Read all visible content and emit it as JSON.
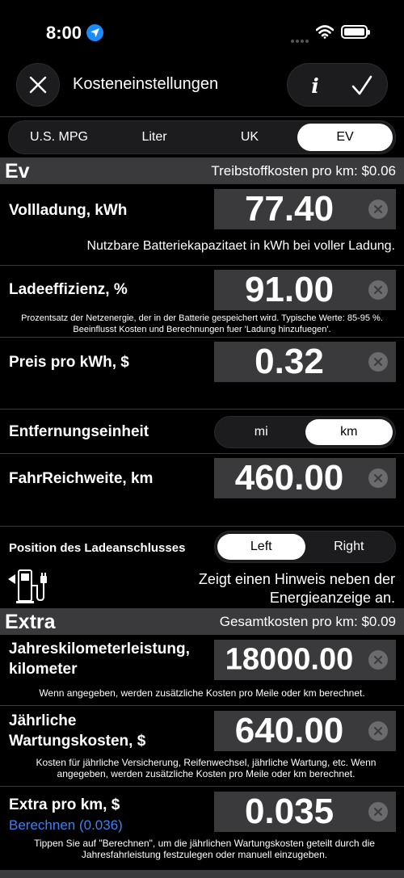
{
  "status": {
    "time": "8:00"
  },
  "nav": {
    "title": "Kosteneinstellungen",
    "info_label": "i"
  },
  "units": {
    "options": [
      "U.S. MPG",
      "Liter",
      "UK",
      "EV"
    ],
    "selected": "EV"
  },
  "ev_section": {
    "title": "Ev",
    "subtitle": "Treibstoffkosten pro km: $0.06"
  },
  "full_charge": {
    "label": "Vollladung, kWh",
    "value": "77.40",
    "hint": "Nutzbare Batteriekapazitaet in kWh bei voller Ladung."
  },
  "charge_efficiency": {
    "label": "Ladeeffizienz, %",
    "value": "91.00",
    "hint": "Prozentsatz der Netzenergie, der in der Batterie gespeichert wird. Typische Werte: 85-95 %. Beeinflusst Kosten und Berechnungen fuer 'Ladung hinzufuegen'."
  },
  "price_kwh": {
    "label": "Preis pro kWh, $",
    "value": "0.32"
  },
  "distance_unit": {
    "label": "Entfernungseinheit",
    "options": [
      "mi",
      "km"
    ],
    "selected": "km"
  },
  "range": {
    "label": "FahrReichweite, km",
    "value": "460.00"
  },
  "charge_port": {
    "label": "Position des Ladeanschlusses",
    "options": [
      "Left",
      "Right"
    ],
    "selected": "Left",
    "hint": "Zeigt einen Hinweis neben der Energieanzeige an."
  },
  "extra_section": {
    "title": "Extra",
    "subtitle": "Gesamtkosten pro km: $0.09"
  },
  "annual_km": {
    "label": "Jahreskilometerleistung, kilometer",
    "value": "18000.00",
    "hint": "Wenn angegeben, werden zusätzliche Kosten pro Meile oder km berechnet."
  },
  "maintenance": {
    "label": "Jährliche Wartungskosten, $",
    "value": "640.00",
    "hint": "Kosten für jährliche Versicherung, Reifenwechsel, jährliche Wartung, etc. Wenn angegeben, werden zusätzliche Kosten pro Meile oder km berechnet."
  },
  "extra_per_km": {
    "label": "Extra pro km, $",
    "value": "0.035",
    "link": "Berechnen (0.036)",
    "hint": "Tippen Sie auf \"Berechnen\", um die jährlichen Wartungskosten geteilt durch die Jahresfahrleistung festzulegen oder manuell einzugeben."
  },
  "colors": {
    "background": "#000000",
    "section": "#3a3a3c",
    "link": "#3b82f6",
    "location": "#1a8cff"
  }
}
